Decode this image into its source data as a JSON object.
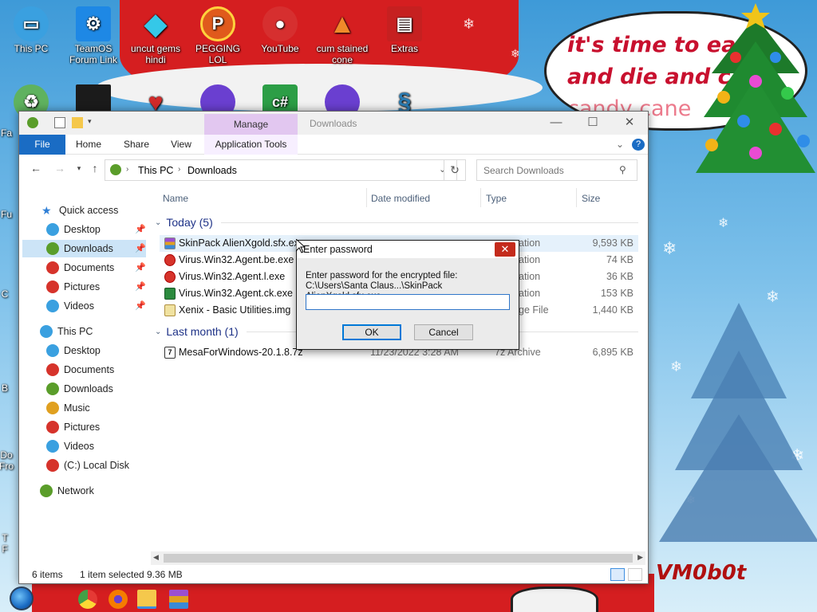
{
  "desktop": {
    "icons": [
      {
        "label": "This PC",
        "icon": "this-pc-icon",
        "color": "#3aa0e0"
      },
      {
        "label": "TeamOS Forum Link",
        "icon": "gear-icon",
        "color": "#1e88e5"
      },
      {
        "label": "uncut gems hindi",
        "icon": "diamond-icon",
        "color": "#35c8e8"
      },
      {
        "label": "PEGGING LOL",
        "icon": "p-logo-icon",
        "color": "#e05a1c"
      },
      {
        "label": "YouTube",
        "icon": "angry-bird-icon",
        "color": "#d62f2f"
      },
      {
        "label": "cum stained cone",
        "icon": "traffic-cone-icon",
        "color": "#f08a2a"
      },
      {
        "label": "Extras",
        "icon": "archive-icon",
        "color": "#c62020"
      }
    ],
    "second_row_icons": [
      "recycle-bin-icon",
      "black-box-icon",
      "red-heart-icon",
      "purple-orb-icon",
      "csharp-icon",
      "purple-orb-icon",
      "snake-icon"
    ],
    "left_partial_labels": [
      "Fa",
      "Fu",
      "C",
      "B",
      "Do",
      "Fro",
      "T",
      "F"
    ],
    "speech_bubble": {
      "line1": "it's time to eat",
      "line2": "and die and c",
      "line3": "candy cane"
    },
    "watermark": "VM0b0t"
  },
  "explorer": {
    "title": "Downloads",
    "contextual_tab": "Manage",
    "ribbon_tabs": [
      "File",
      "Home",
      "Share",
      "View",
      "Application Tools"
    ],
    "breadcrumb": [
      "This PC",
      "Downloads"
    ],
    "search_placeholder": "Search Downloads",
    "nav": {
      "quick_access": "Quick access",
      "quick_items": [
        "Desktop",
        "Downloads",
        "Documents",
        "Pictures",
        "Videos"
      ],
      "this_pc": "This PC",
      "pc_items": [
        "Desktop",
        "Documents",
        "Downloads",
        "Music",
        "Pictures",
        "Videos",
        "(C:) Local Disk"
      ],
      "network": "Network"
    },
    "columns": [
      "Name",
      "Date modified",
      "Type",
      "Size"
    ],
    "groups": [
      {
        "label": "Today (5)",
        "files": [
          {
            "name": "SkinPack AlienXgold.sfx.exe",
            "date": "",
            "type": "ation",
            "size": "9,593 KB",
            "selected": true,
            "icon": "winrar-sfx-icon"
          },
          {
            "name": "Virus.Win32.Agent.be.exe",
            "date": "",
            "type": "ation",
            "size": "74 KB",
            "selected": false,
            "icon": "red-orb-icon"
          },
          {
            "name": "Virus.Win32.Agent.l.exe",
            "date": "",
            "type": "ation",
            "size": "36 KB",
            "selected": false,
            "icon": "red-orb-icon"
          },
          {
            "name": "Virus.Win32.Agent.ck.exe",
            "date": "",
            "type": "ation",
            "size": "153 KB",
            "selected": false,
            "icon": "green-chip-icon"
          },
          {
            "name": "Xenix - Basic Utilities.img",
            "date": "",
            "type": "ge File",
            "size": "1,440 KB",
            "selected": false,
            "icon": "disk-image-icon"
          }
        ]
      },
      {
        "label": "Last month (1)",
        "files": [
          {
            "name": "MesaForWindows-20.1.8.7z",
            "date": "11/23/2022 3:28 AM",
            "type": "7z Archive",
            "size": "6,895 KB",
            "selected": false,
            "icon": "7z-archive-icon"
          }
        ]
      }
    ],
    "status": {
      "items": "6 items",
      "selected": "1 item selected",
      "size": "9.36 MB"
    }
  },
  "dialog": {
    "title": "Enter password",
    "prompt_line1": "Enter password for the encrypted file:",
    "prompt_line2": "C:\\Users\\Santa Claus...\\SkinPack AlienXgold.sfx.exe",
    "password_value": "",
    "ok_label": "OK",
    "cancel_label": "Cancel"
  },
  "colors": {
    "accent": "#1a6cc4",
    "manage_tab": "#e2c7f0",
    "selection": "#cce4f7",
    "close_red": "#c42b1c"
  }
}
